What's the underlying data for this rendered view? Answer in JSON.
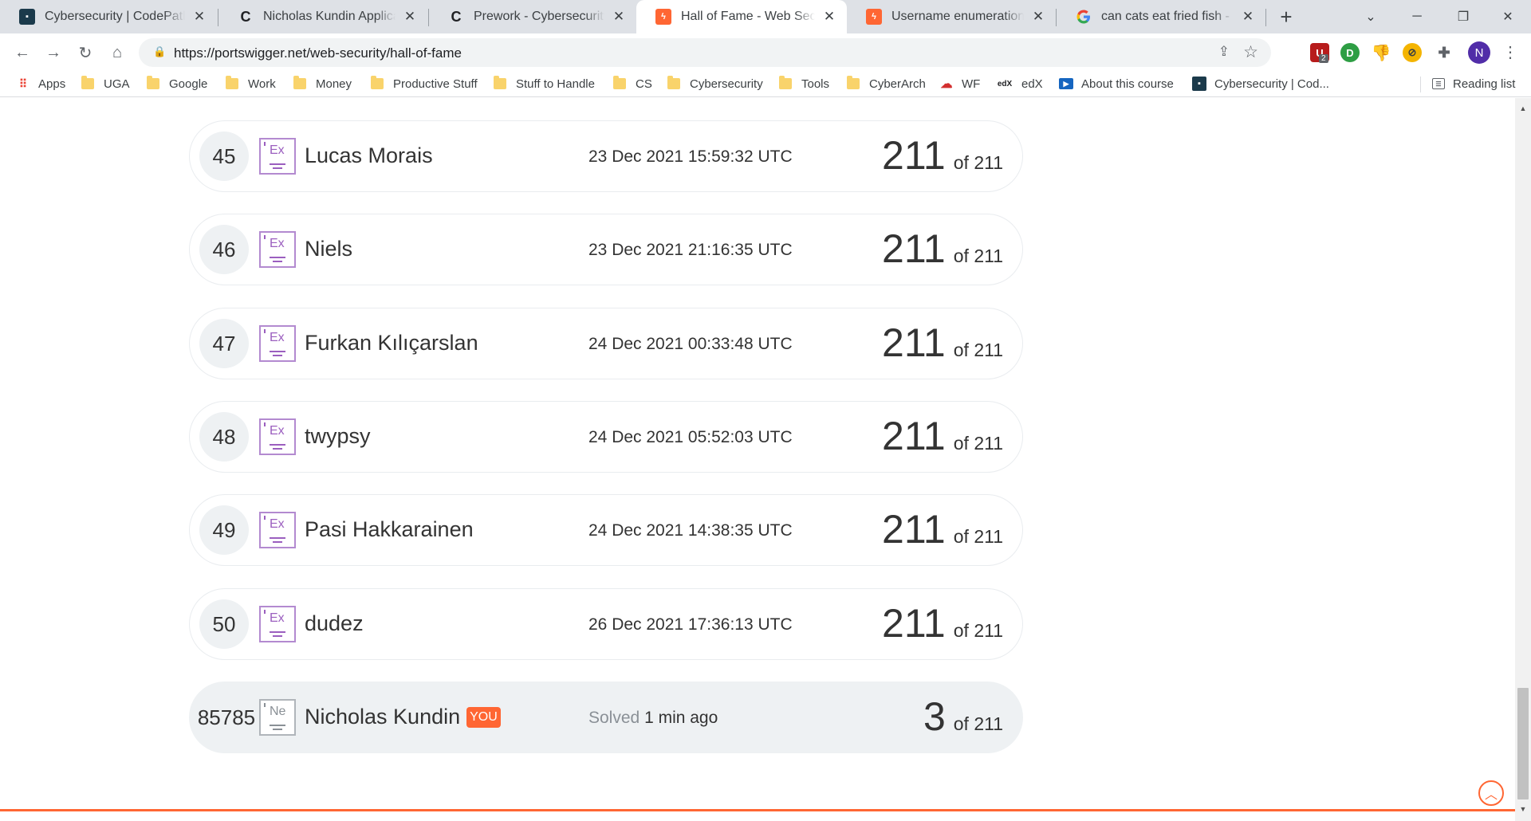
{
  "browser": {
    "tabs": [
      {
        "title": "Cybersecurity | CodePath.org",
        "favicon": "codepath-icon"
      },
      {
        "title": "Nicholas Kundin Application",
        "favicon": "codepath-c-icon"
      },
      {
        "title": "Prework - Cybersecurity University",
        "favicon": "codepath-c-icon"
      },
      {
        "title": "Hall of Fame - Web Security Academy",
        "favicon": "portswigger-icon"
      },
      {
        "title": "Username enumeration via",
        "favicon": "portswigger-icon"
      },
      {
        "title": "can cats eat fried fish - Google",
        "favicon": "google-icon"
      }
    ],
    "url": "https://portswigger.net/web-security/hall-of-fame",
    "profile_initial": "N",
    "extension_badge": "2",
    "bookmarks": [
      {
        "label": "Apps",
        "type": "apps"
      },
      {
        "label": "UGA",
        "type": "folder"
      },
      {
        "label": "Google",
        "type": "folder"
      },
      {
        "label": "Work",
        "type": "folder"
      },
      {
        "label": "Money",
        "type": "folder"
      },
      {
        "label": "Productive Stuff",
        "type": "folder"
      },
      {
        "label": "Stuff to Handle",
        "type": "folder"
      },
      {
        "label": "CS",
        "type": "folder"
      },
      {
        "label": "Cybersecurity",
        "type": "folder"
      },
      {
        "label": "Tools",
        "type": "folder"
      },
      {
        "label": "CyberArch",
        "type": "folder"
      },
      {
        "label": "WF",
        "type": "site"
      },
      {
        "label": "edX",
        "type": "site"
      },
      {
        "label": "About this course",
        "type": "site"
      },
      {
        "label": "Cybersecurity | Cod...",
        "type": "site"
      }
    ],
    "reading_list": "Reading list"
  },
  "leaderboard": {
    "rows": [
      {
        "rank": "45",
        "level": "Ex",
        "name": "Lucas Morais",
        "date": "23 Dec 2021 15:59:32 UTC",
        "solved": "211",
        "of": "of 211"
      },
      {
        "rank": "46",
        "level": "Ex",
        "name": "Niels",
        "date": "23 Dec 2021 21:16:35 UTC",
        "solved": "211",
        "of": "of 211"
      },
      {
        "rank": "47",
        "level": "Ex",
        "name": "Furkan Kılıçarslan",
        "date": "24 Dec 2021 00:33:48 UTC",
        "solved": "211",
        "of": "of 211"
      },
      {
        "rank": "48",
        "level": "Ex",
        "name": "twypsy",
        "date": "24 Dec 2021 05:52:03 UTC",
        "solved": "211",
        "of": "of 211"
      },
      {
        "rank": "49",
        "level": "Ex",
        "name": "Pasi Hakkarainen",
        "date": "24 Dec 2021 14:38:35 UTC",
        "solved": "211",
        "of": "of 211"
      },
      {
        "rank": "50",
        "level": "Ex",
        "name": "dudez",
        "date": "26 Dec 2021 17:36:13 UTC",
        "solved": "211",
        "of": "of 211"
      }
    ],
    "current_user": {
      "rank": "85785",
      "level": "Ne",
      "name": "Nicholas Kundin",
      "badge": "YOU",
      "solved_label": "Solved",
      "solved_time": "1 min ago",
      "solved": "3",
      "of": "of 211"
    }
  },
  "colors": {
    "accent": "#ff6633",
    "expert_level": "#9b5fbf",
    "row_highlight": "#eef1f3"
  }
}
